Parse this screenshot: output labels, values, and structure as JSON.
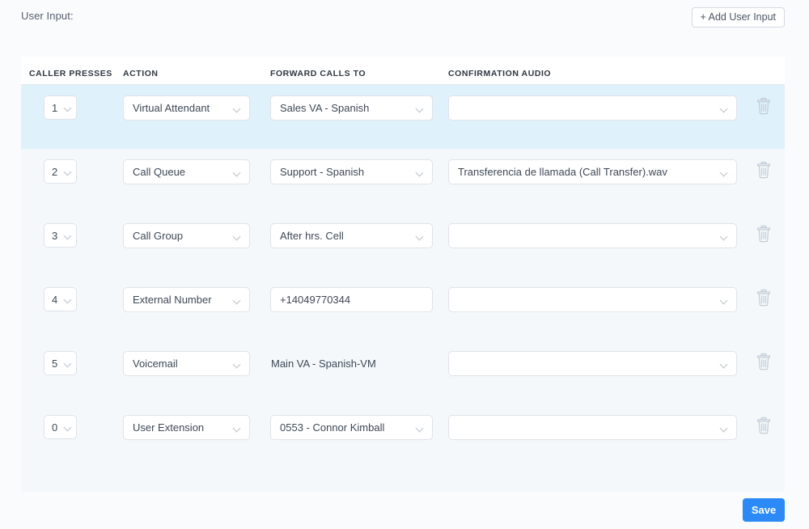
{
  "header": {
    "label": "User Input:",
    "add_button": "+ Add User Input"
  },
  "table": {
    "columns": [
      "CALLER PRESSES",
      "ACTION",
      "FORWARD CALLS TO",
      "CONFIRMATION AUDIO"
    ],
    "rows": [
      {
        "caller_presses": "1",
        "action": "Virtual Attendant",
        "forward_to": "Sales VA - Spanish",
        "forward_to_type": "select",
        "confirmation_audio": "",
        "highlighted": true,
        "delete_icon": "trash-icon"
      },
      {
        "caller_presses": "2",
        "action": "Call Queue",
        "forward_to": "Support - Spanish",
        "forward_to_type": "select",
        "confirmation_audio": "Transferencia de llamada (Call Transfer).wav",
        "highlighted": false,
        "delete_icon": "trash-icon"
      },
      {
        "caller_presses": "3",
        "action": "Call Group",
        "forward_to": "After hrs. Cell",
        "forward_to_type": "select",
        "confirmation_audio": "",
        "highlighted": false,
        "delete_icon": "trash-icon"
      },
      {
        "caller_presses": "4",
        "action": "External Number",
        "forward_to": "+14049770344",
        "forward_to_type": "text",
        "confirmation_audio": "",
        "highlighted": false,
        "delete_icon": "trash-icon"
      },
      {
        "caller_presses": "5",
        "action": "Voicemail",
        "forward_to": "Main VA - Spanish-VM",
        "forward_to_type": "plain",
        "confirmation_audio": "",
        "highlighted": false,
        "delete_icon": "trash-icon"
      },
      {
        "caller_presses": "0",
        "action": "User Extension",
        "forward_to": "0553 - Connor Kimball",
        "forward_to_type": "select",
        "confirmation_audio": "",
        "highlighted": false,
        "delete_icon": "trash-icon"
      }
    ]
  },
  "footer": {
    "save_label": "Save"
  },
  "colors": {
    "page_background": "#fafbfc",
    "table_body_background": "#f4f8fb",
    "row_highlight": "#dff1fb",
    "accent": "#2b8af5",
    "field_border": "#dfe3e8",
    "text": "#3e4855"
  }
}
